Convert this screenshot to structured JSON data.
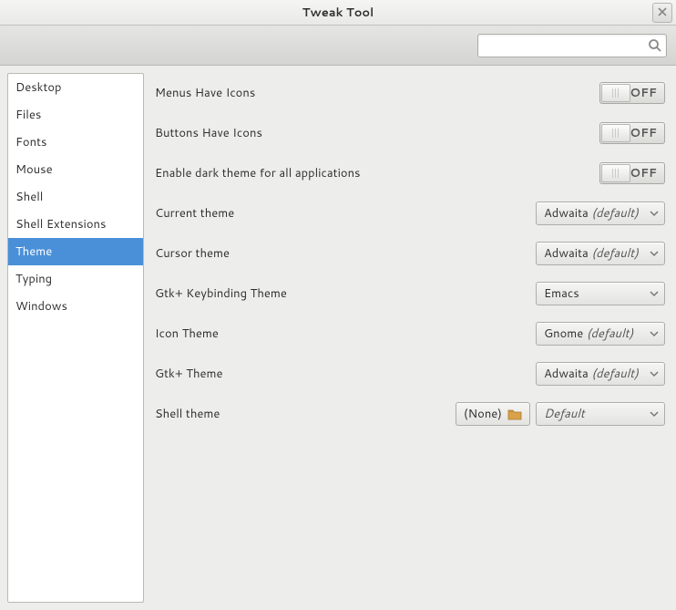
{
  "window": {
    "title": "Tweak Tool"
  },
  "search": {
    "placeholder": ""
  },
  "sidebar": {
    "items": [
      {
        "label": "Desktop",
        "selected": false
      },
      {
        "label": "Files",
        "selected": false
      },
      {
        "label": "Fonts",
        "selected": false
      },
      {
        "label": "Mouse",
        "selected": false
      },
      {
        "label": "Shell",
        "selected": false
      },
      {
        "label": "Shell Extensions",
        "selected": false
      },
      {
        "label": "Theme",
        "selected": true
      },
      {
        "label": "Typing",
        "selected": false
      },
      {
        "label": "Windows",
        "selected": false
      }
    ]
  },
  "main": {
    "menus_icons": {
      "label": "Menus Have Icons",
      "state": "OFF"
    },
    "buttons_icons": {
      "label": "Buttons Have Icons",
      "state": "OFF"
    },
    "dark_theme": {
      "label": "Enable dark theme for all applications",
      "state": "OFF"
    },
    "current_theme": {
      "label": "Current theme",
      "value": "Adwaita",
      "default": true
    },
    "cursor_theme": {
      "label": "Cursor theme",
      "value": "Adwaita",
      "default": true
    },
    "keybinding": {
      "label": "Gtk+ Keybinding Theme",
      "value": "Emacs",
      "default": false
    },
    "icon_theme": {
      "label": "Icon Theme",
      "value": "Gnome",
      "default": true
    },
    "gtk_theme": {
      "label": "Gtk+ Theme",
      "value": "Adwaita",
      "default": true
    },
    "shell_theme": {
      "label": "Shell theme",
      "file": "(None)",
      "value": "Default",
      "default": false,
      "default_italic": true
    }
  },
  "strings": {
    "default_suffix": "(default)"
  }
}
